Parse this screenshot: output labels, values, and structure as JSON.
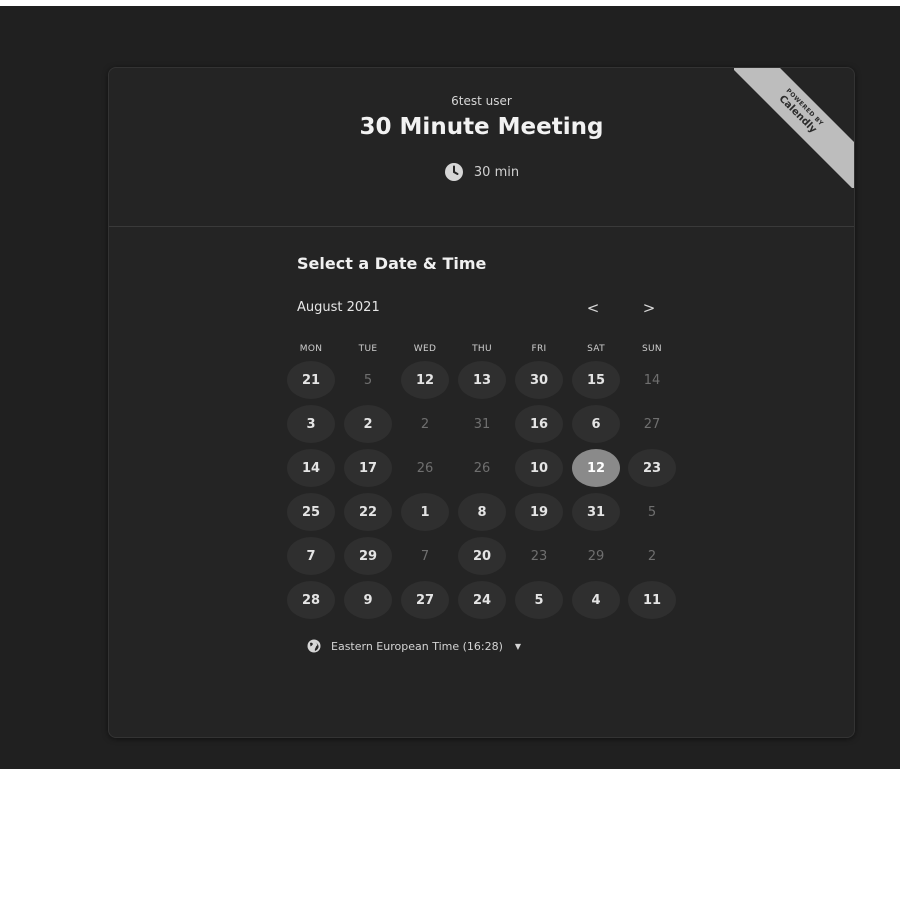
{
  "brand": {
    "powered_by": "POWERED BY",
    "name": "Calendly"
  },
  "event": {
    "user_name": "6test user",
    "title": "30 Minute Meeting",
    "duration": "30 min",
    "duration_icon": "clock-icon"
  },
  "picker": {
    "section_title": "Select a Date & Time",
    "month_label": "August 2021",
    "prev_label": "<",
    "next_label": ">",
    "weekdays": [
      "MON",
      "TUE",
      "WED",
      "THU",
      "FRI",
      "SAT",
      "SUN"
    ],
    "weeks": [
      [
        {
          "d": "21",
          "s": "available"
        },
        {
          "d": "5",
          "s": "disabled"
        },
        {
          "d": "12",
          "s": "available"
        },
        {
          "d": "13",
          "s": "available"
        },
        {
          "d": "30",
          "s": "available"
        },
        {
          "d": "15",
          "s": "available"
        },
        {
          "d": "14",
          "s": "disabled"
        }
      ],
      [
        {
          "d": "3",
          "s": "available"
        },
        {
          "d": "2",
          "s": "available"
        },
        {
          "d": "2",
          "s": "disabled"
        },
        {
          "d": "31",
          "s": "disabled"
        },
        {
          "d": "16",
          "s": "available"
        },
        {
          "d": "6",
          "s": "available"
        },
        {
          "d": "27",
          "s": "disabled"
        }
      ],
      [
        {
          "d": "14",
          "s": "available"
        },
        {
          "d": "17",
          "s": "available"
        },
        {
          "d": "26",
          "s": "disabled"
        },
        {
          "d": "26",
          "s": "disabled"
        },
        {
          "d": "10",
          "s": "available"
        },
        {
          "d": "12",
          "s": "selected"
        },
        {
          "d": "23",
          "s": "available"
        }
      ],
      [
        {
          "d": "25",
          "s": "available"
        },
        {
          "d": "22",
          "s": "available"
        },
        {
          "d": "1",
          "s": "available"
        },
        {
          "d": "8",
          "s": "available"
        },
        {
          "d": "19",
          "s": "available"
        },
        {
          "d": "31",
          "s": "available"
        },
        {
          "d": "5",
          "s": "disabled"
        }
      ],
      [
        {
          "d": "7",
          "s": "available"
        },
        {
          "d": "29",
          "s": "available"
        },
        {
          "d": "7",
          "s": "disabled"
        },
        {
          "d": "20",
          "s": "available"
        },
        {
          "d": "23",
          "s": "disabled"
        },
        {
          "d": "29",
          "s": "disabled"
        },
        {
          "d": "2",
          "s": "disabled"
        }
      ],
      [
        {
          "d": "28",
          "s": "available"
        },
        {
          "d": "9",
          "s": "available"
        },
        {
          "d": "27",
          "s": "available"
        },
        {
          "d": "24",
          "s": "available"
        },
        {
          "d": "5",
          "s": "available"
        },
        {
          "d": "4",
          "s": "available"
        },
        {
          "d": "11",
          "s": "available"
        }
      ]
    ]
  },
  "timezone": {
    "label": "Eastern European Time (16:28)",
    "icon": "globe-icon"
  }
}
